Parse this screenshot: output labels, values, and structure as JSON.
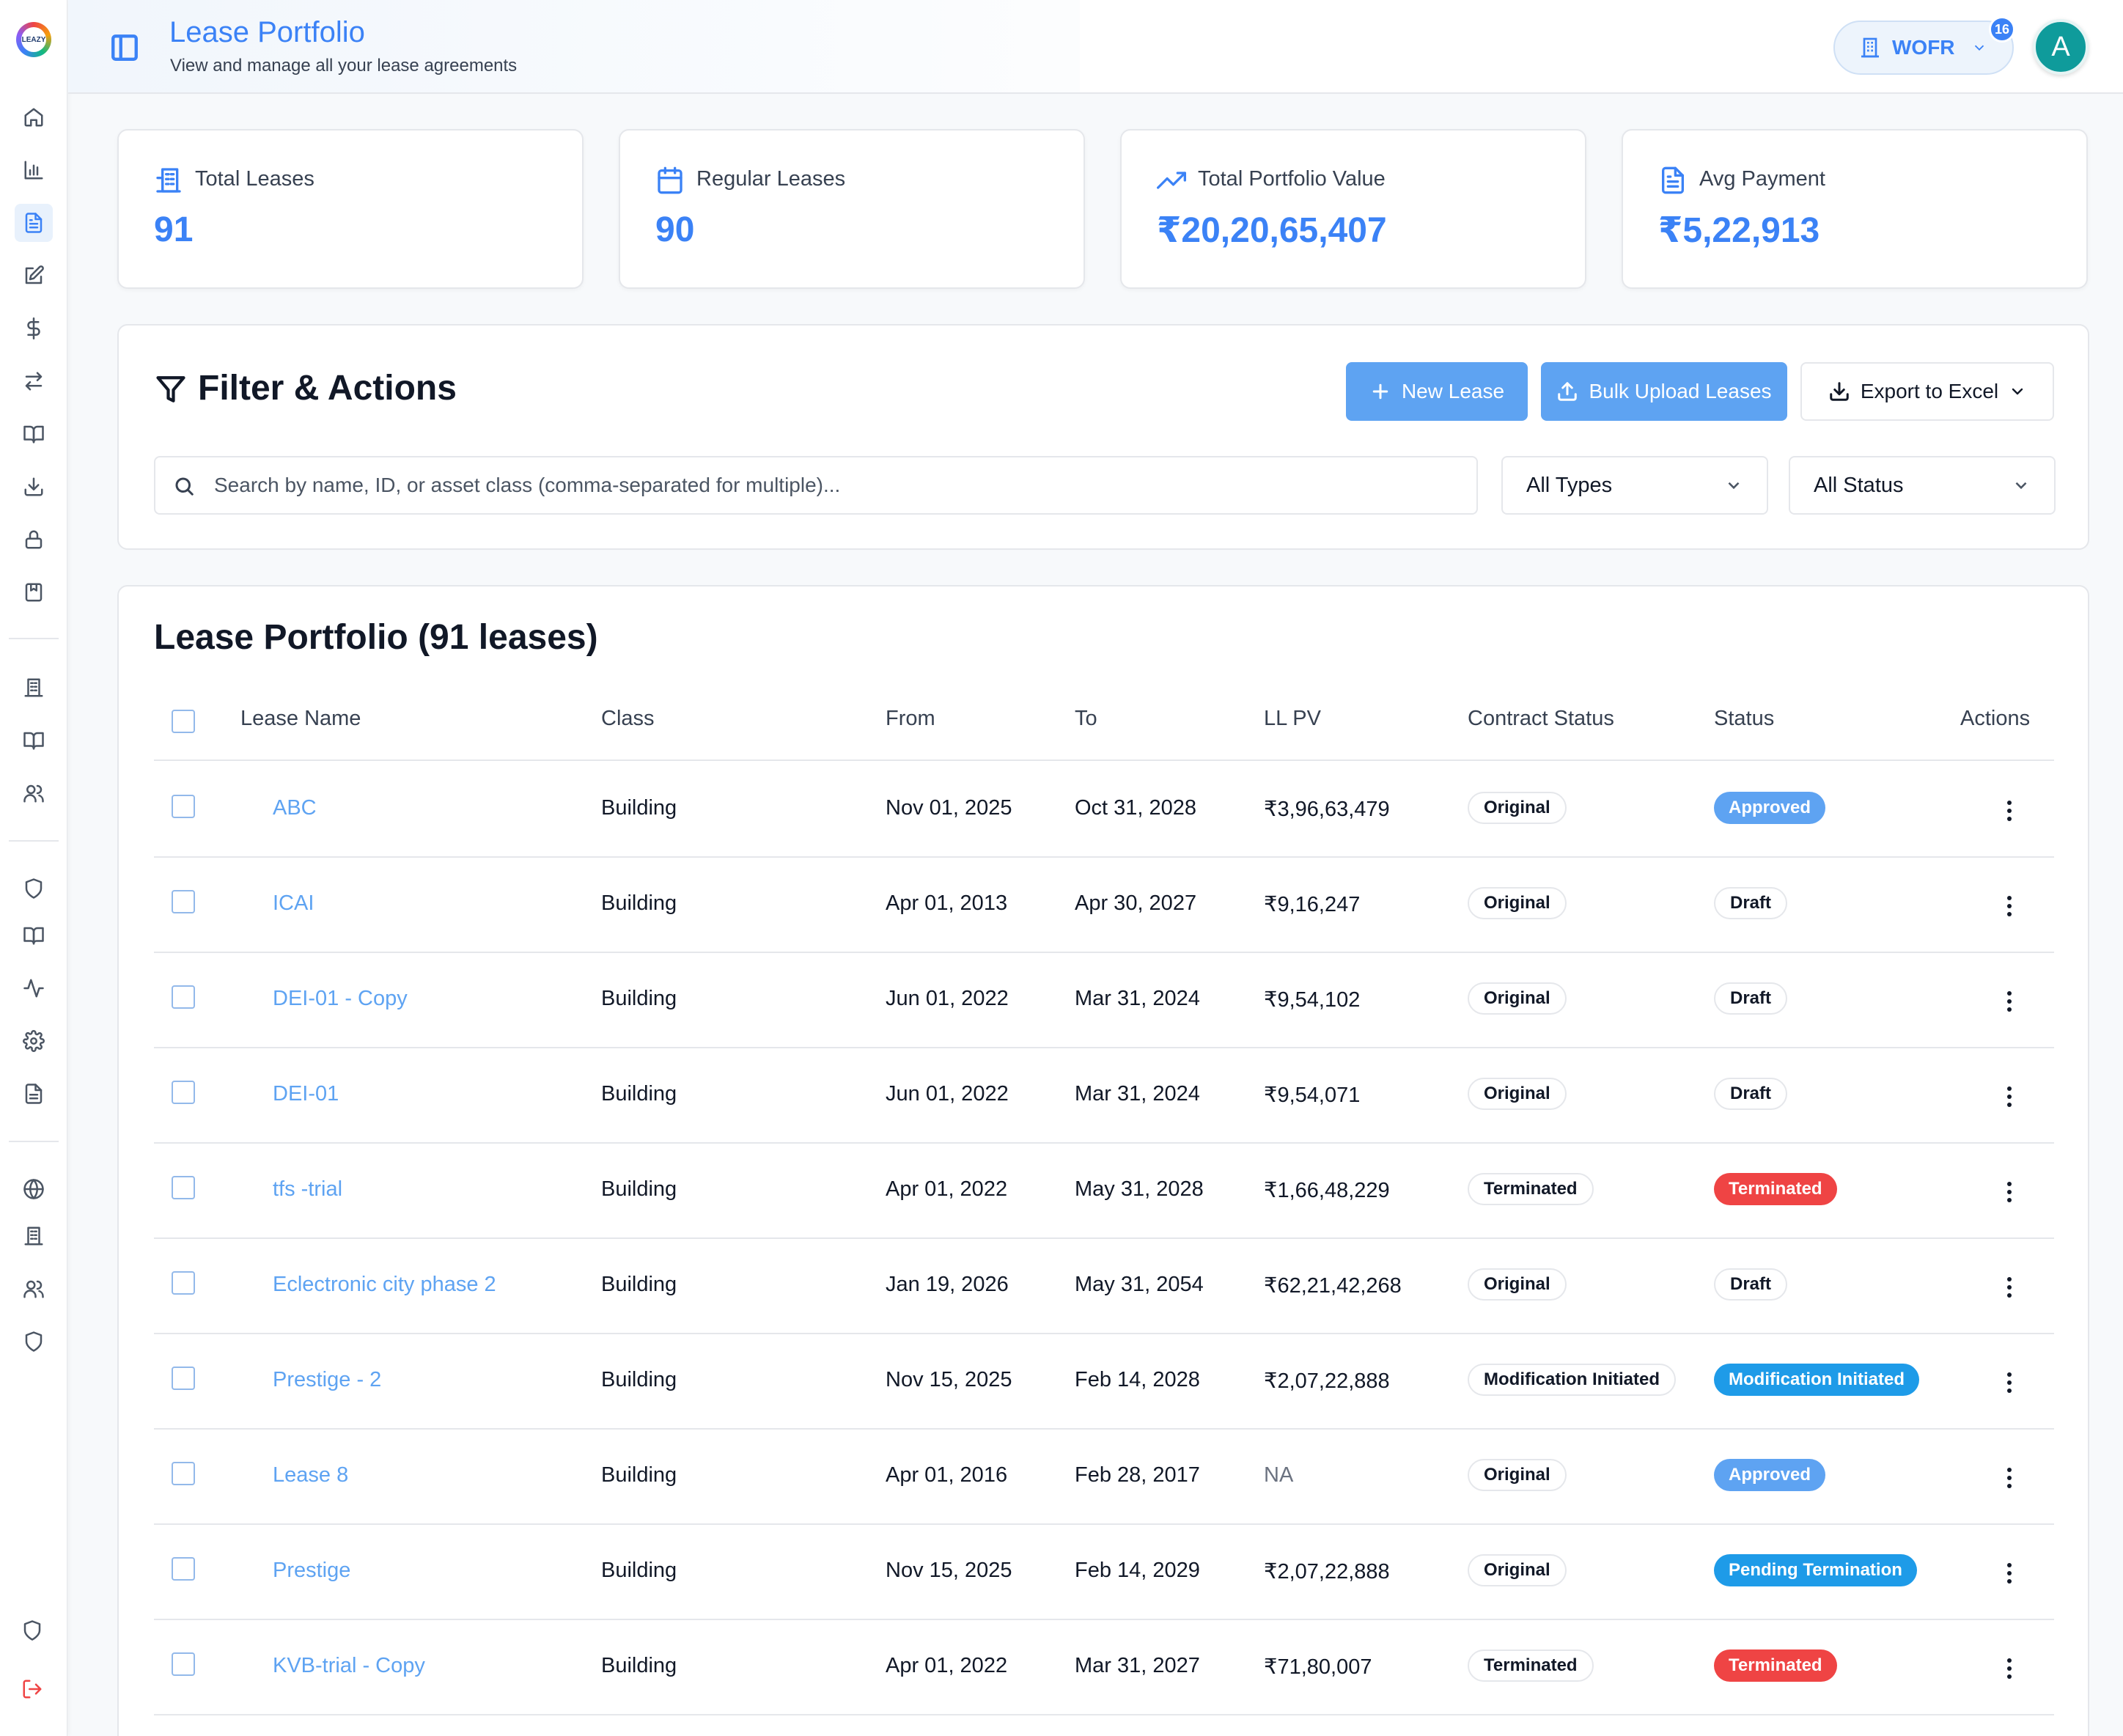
{
  "app": {
    "logo_text": "LEAZY"
  },
  "header": {
    "title": "Lease Portfolio",
    "subtitle": "View and manage all your lease agreements",
    "org_label": "WOFR",
    "notification_count": "16",
    "avatar_initial": "A"
  },
  "sidebar": {
    "icons": [
      "home-icon",
      "bar-chart-icon",
      "document-icon",
      "edit-icon",
      "dollar-icon",
      "transfer-icon",
      "book-icon",
      "download-icon",
      "lock-icon",
      "bookmark-icon",
      "building-icon",
      "book-open-icon",
      "users-icon",
      "shield-icon",
      "book-open-icon",
      "activity-icon",
      "settings-icon",
      "file-text-icon",
      "globe-icon",
      "building-icon",
      "users-icon",
      "shield-icon",
      "shield-icon",
      "logout-icon"
    ],
    "active": "document-icon"
  },
  "stats": [
    {
      "label": "Total Leases",
      "value": "91",
      "icon": "building-icon"
    },
    {
      "label": "Regular Leases",
      "value": "90",
      "icon": "calendar-icon"
    },
    {
      "label": "Total Portfolio Value",
      "value": "₹20,20,65,407",
      "icon": "trending-up-icon"
    },
    {
      "label": "Avg Payment",
      "value": "₹5,22,913",
      "icon": "file-icon"
    }
  ],
  "filters": {
    "title": "Filter & Actions",
    "new_lease": "New Lease",
    "bulk_upload": "Bulk Upload Leases",
    "export": "Export to Excel",
    "search_placeholder": "Search by name, ID, or asset class (comma-separated for multiple)...",
    "type_select": "All Types",
    "status_select": "All Status"
  },
  "table": {
    "title": "Lease Portfolio (91 leases)",
    "columns": [
      "Lease Name",
      "Class",
      "From",
      "To",
      "LL PV",
      "Contract Status",
      "Status",
      "Actions"
    ],
    "rows": [
      {
        "name": "ABC",
        "class": "Building",
        "from": "Nov 01, 2025",
        "to": "Oct 31, 2028",
        "llpv": "₹3,96,63,479",
        "contract": "Original",
        "status": "Approved",
        "status_style": "blue"
      },
      {
        "name": "ICAI",
        "class": "Building",
        "from": "Apr 01, 2013",
        "to": "Apr 30, 2027",
        "llpv": "₹9,16,247",
        "contract": "Original",
        "status": "Draft",
        "status_style": "outline"
      },
      {
        "name": "DEI-01 - Copy",
        "class": "Building",
        "from": "Jun 01, 2022",
        "to": "Mar 31, 2024",
        "llpv": "₹9,54,102",
        "contract": "Original",
        "status": "Draft",
        "status_style": "outline"
      },
      {
        "name": "DEI-01",
        "class": "Building",
        "from": "Jun 01, 2022",
        "to": "Mar 31, 2024",
        "llpv": "₹9,54,071",
        "contract": "Original",
        "status": "Draft",
        "status_style": "outline"
      },
      {
        "name": "tfs -trial",
        "class": "Building",
        "from": "Apr 01, 2022",
        "to": "May 31, 2028",
        "llpv": "₹1,66,48,229",
        "contract": "Terminated",
        "status": "Terminated",
        "status_style": "red"
      },
      {
        "name": "Eclectronic city phase 2",
        "class": "Building",
        "from": "Jan 19, 2026",
        "to": "May 31, 2054",
        "llpv": "₹62,21,42,268",
        "contract": "Original",
        "status": "Draft",
        "status_style": "outline"
      },
      {
        "name": "Prestige - 2",
        "class": "Building",
        "from": "Nov 15, 2025",
        "to": "Feb 14, 2028",
        "llpv": "₹2,07,22,888",
        "contract": "Modification Initiated",
        "status": "Modification Initiated",
        "status_style": "blue2"
      },
      {
        "name": "Lease 8",
        "class": "Building",
        "from": "Apr 01, 2016",
        "to": "Feb 28, 2017",
        "llpv": "NA",
        "contract": "Original",
        "status": "Approved",
        "status_style": "blue"
      },
      {
        "name": "Prestige",
        "class": "Building",
        "from": "Nov 15, 2025",
        "to": "Feb 14, 2029",
        "llpv": "₹2,07,22,888",
        "contract": "Original",
        "status": "Pending Termination",
        "status_style": "blue2"
      },
      {
        "name": "KVB-trial - Copy",
        "class": "Building",
        "from": "Apr 01, 2022",
        "to": "Mar 31, 2027",
        "llpv": "₹71,80,007",
        "contract": "Terminated",
        "status": "Terminated",
        "status_style": "red"
      }
    ]
  }
}
